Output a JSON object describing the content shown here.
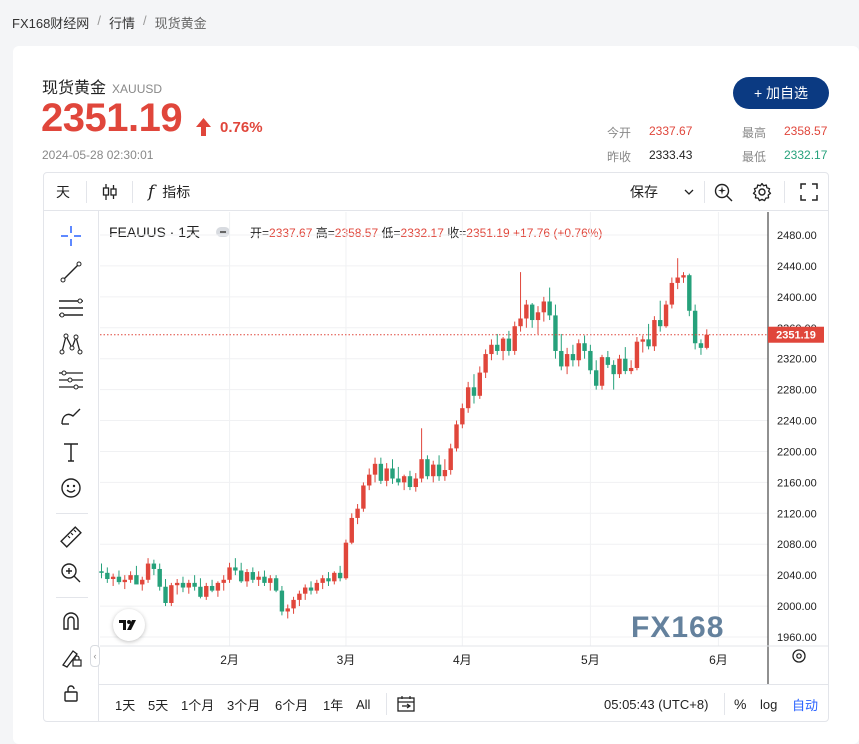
{
  "breadcrumb": {
    "home": "FX168财经网",
    "sep": "/",
    "market": "行情",
    "current": "现货黄金"
  },
  "header": {
    "name": "现货黄金",
    "code": "XAUUSD",
    "price": "2351.19",
    "change_pct": "0.76%",
    "timestamp": "2024-05-28 02:30:01",
    "add_button": "+ 加自选",
    "colors": {
      "up": "#e0463b",
      "down": "#26a17b",
      "button": "#0b3a82"
    }
  },
  "stats": {
    "open_label": "今开",
    "open": "2337.67",
    "high_label": "最高",
    "high": "2358.57",
    "prev_label": "昨收",
    "prev": "2333.43",
    "low_label": "最低",
    "low": "2332.17"
  },
  "toolbar": {
    "interval": "天",
    "indicators": "指标",
    "save": "保存"
  },
  "legend": {
    "symbol": "FEAUUS · 1天",
    "open_label": "开=",
    "open": "2337.67",
    "high_label": "高=",
    "high": "2358.57",
    "low_label": "低=",
    "low": "2332.17",
    "close_label": "收=",
    "close": "2351.19",
    "change": "+17.76 (+0.76%)"
  },
  "bottombar": {
    "ranges": [
      "1天",
      "5天",
      "1个月",
      "3个月",
      "6个月",
      "1年",
      "All"
    ],
    "time": "05:05:43 (UTC+8)",
    "percent": "%",
    "log": "log",
    "auto": "自动"
  },
  "watermark": "FX168",
  "chart_data": {
    "type": "candlestick",
    "price_label": "2351.19",
    "ylim": [
      1940,
      2500
    ],
    "y_ticks": [
      "2480.00",
      "2440.00",
      "2400.00",
      "2360.00",
      "2320.00",
      "2280.00",
      "2240.00",
      "2200.00",
      "2160.00",
      "2120.00",
      "2080.00",
      "2040.00",
      "2000.00",
      "1960.00"
    ],
    "x_ticks": [
      {
        "label": "2月",
        "index": 22
      },
      {
        "label": "3月",
        "index": 42
      },
      {
        "label": "4月",
        "index": 62
      },
      {
        "label": "5月",
        "index": 84
      },
      {
        "label": "6月",
        "index": 106
      }
    ],
    "candles": [
      [
        2045,
        2055,
        2036,
        2043
      ],
      [
        2043,
        2050,
        2030,
        2035
      ],
      [
        2035,
        2042,
        2026,
        2038
      ],
      [
        2038,
        2046,
        2028,
        2031
      ],
      [
        2031,
        2040,
        2022,
        2034
      ],
      [
        2034,
        2045,
        2030,
        2040
      ],
      [
        2040,
        2052,
        2034,
        2028
      ],
      [
        2028,
        2038,
        2020,
        2034
      ],
      [
        2034,
        2062,
        2030,
        2055
      ],
      [
        2055,
        2060,
        2040,
        2048
      ],
      [
        2048,
        2055,
        2020,
        2025
      ],
      [
        2025,
        2035,
        2000,
        2004
      ],
      [
        2004,
        2030,
        2000,
        2027
      ],
      [
        2027,
        2035,
        2015,
        2030
      ],
      [
        2030,
        2038,
        2018,
        2024
      ],
      [
        2024,
        2034,
        2016,
        2030
      ],
      [
        2030,
        2040,
        2020,
        2025
      ],
      [
        2025,
        2036,
        2010,
        2012
      ],
      [
        2012,
        2030,
        2008,
        2026
      ],
      [
        2026,
        2034,
        2018,
        2020
      ],
      [
        2020,
        2032,
        2012,
        2030
      ],
      [
        2030,
        2040,
        2020,
        2034
      ],
      [
        2034,
        2056,
        2030,
        2050
      ],
      [
        2050,
        2062,
        2040,
        2046
      ],
      [
        2046,
        2056,
        2030,
        2032
      ],
      [
        2032,
        2048,
        2025,
        2044
      ],
      [
        2044,
        2050,
        2030,
        2034
      ],
      [
        2034,
        2045,
        2026,
        2038
      ],
      [
        2038,
        2046,
        2026,
        2030
      ],
      [
        2030,
        2040,
        2020,
        2036
      ],
      [
        2036,
        2040,
        2018,
        2020
      ],
      [
        2020,
        2026,
        1988,
        1993
      ],
      [
        1993,
        2002,
        1984,
        1997
      ],
      [
        1997,
        2012,
        1990,
        2008
      ],
      [
        2008,
        2020,
        2000,
        2016
      ],
      [
        2016,
        2028,
        2008,
        2024
      ],
      [
        2024,
        2032,
        2015,
        2020
      ],
      [
        2020,
        2034,
        2016,
        2030
      ],
      [
        2030,
        2040,
        2022,
        2036
      ],
      [
        2036,
        2044,
        2026,
        2032
      ],
      [
        2032,
        2045,
        2028,
        2043
      ],
      [
        2043,
        2052,
        2032,
        2036
      ],
      [
        2036,
        2086,
        2034,
        2082
      ],
      [
        2082,
        2120,
        2080,
        2114
      ],
      [
        2114,
        2132,
        2106,
        2126
      ],
      [
        2126,
        2160,
        2122,
        2156
      ],
      [
        2156,
        2178,
        2150,
        2170
      ],
      [
        2170,
        2192,
        2160,
        2184
      ],
      [
        2184,
        2192,
        2158,
        2162
      ],
      [
        2162,
        2185,
        2155,
        2178
      ],
      [
        2178,
        2190,
        2158,
        2165
      ],
      [
        2165,
        2180,
        2156,
        2160
      ],
      [
        2160,
        2170,
        2150,
        2168
      ],
      [
        2168,
        2175,
        2150,
        2154
      ],
      [
        2154,
        2172,
        2148,
        2165
      ],
      [
        2165,
        2230,
        2160,
        2190
      ],
      [
        2190,
        2195,
        2164,
        2168
      ],
      [
        2168,
        2188,
        2160,
        2183
      ],
      [
        2183,
        2195,
        2162,
        2168
      ],
      [
        2168,
        2190,
        2162,
        2176
      ],
      [
        2176,
        2210,
        2170,
        2204
      ],
      [
        2204,
        2240,
        2200,
        2235
      ],
      [
        2235,
        2262,
        2230,
        2256
      ],
      [
        2256,
        2290,
        2250,
        2283
      ],
      [
        2283,
        2300,
        2262,
        2272
      ],
      [
        2272,
        2310,
        2268,
        2302
      ],
      [
        2302,
        2332,
        2295,
        2326
      ],
      [
        2326,
        2345,
        2318,
        2338
      ],
      [
        2338,
        2352,
        2325,
        2330
      ],
      [
        2330,
        2348,
        2318,
        2346
      ],
      [
        2346,
        2356,
        2324,
        2330
      ],
      [
        2330,
        2368,
        2325,
        2362
      ],
      [
        2362,
        2432,
        2355,
        2372
      ],
      [
        2372,
        2396,
        2360,
        2390
      ],
      [
        2390,
        2392,
        2360,
        2370
      ],
      [
        2370,
        2388,
        2352,
        2380
      ],
      [
        2380,
        2400,
        2368,
        2394
      ],
      [
        2394,
        2412,
        2370,
        2376
      ],
      [
        2376,
        2390,
        2320,
        2330
      ],
      [
        2330,
        2352,
        2305,
        2310
      ],
      [
        2310,
        2334,
        2300,
        2326
      ],
      [
        2326,
        2338,
        2310,
        2318
      ],
      [
        2318,
        2345,
        2310,
        2340
      ],
      [
        2340,
        2350,
        2320,
        2330
      ],
      [
        2330,
        2338,
        2300,
        2305
      ],
      [
        2305,
        2318,
        2280,
        2285
      ],
      [
        2285,
        2325,
        2280,
        2322
      ],
      [
        2322,
        2330,
        2308,
        2312
      ],
      [
        2312,
        2318,
        2280,
        2300
      ],
      [
        2300,
        2325,
        2295,
        2320
      ],
      [
        2320,
        2335,
        2300,
        2304
      ],
      [
        2304,
        2318,
        2300,
        2308
      ],
      [
        2308,
        2348,
        2305,
        2342
      ],
      [
        2342,
        2350,
        2328,
        2345
      ],
      [
        2345,
        2365,
        2332,
        2336
      ],
      [
        2336,
        2375,
        2330,
        2370
      ],
      [
        2370,
        2395,
        2355,
        2362
      ],
      [
        2362,
        2395,
        2360,
        2390
      ],
      [
        2390,
        2425,
        2385,
        2418
      ],
      [
        2418,
        2450,
        2410,
        2425
      ],
      [
        2425,
        2432,
        2418,
        2428
      ],
      [
        2428,
        2430,
        2375,
        2382
      ],
      [
        2382,
        2390,
        2332,
        2340
      ],
      [
        2340,
        2345,
        2325,
        2334
      ],
      [
        2334,
        2358,
        2332,
        2351
      ]
    ]
  }
}
